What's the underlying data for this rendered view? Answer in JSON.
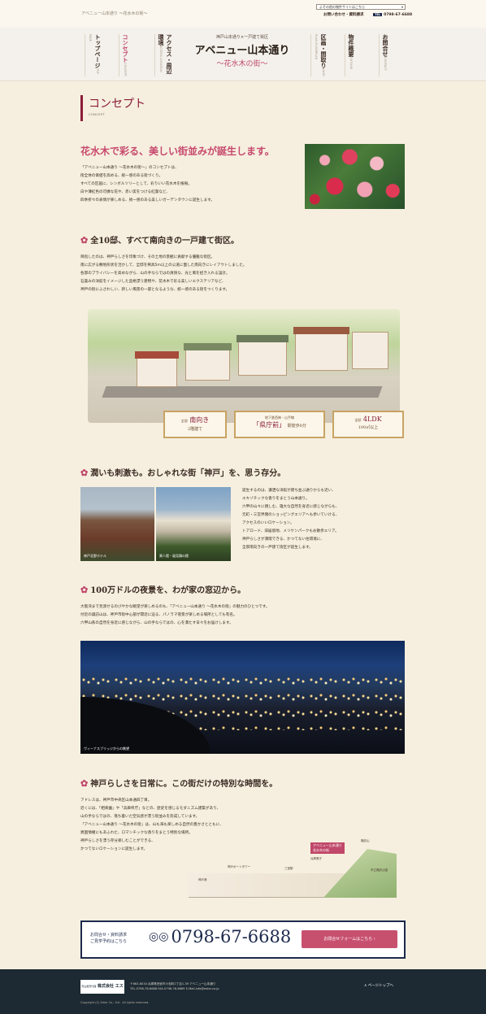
{
  "header": {
    "breadcrumb": "アベニュー山本通り ～花水木の街～",
    "site_select": "よその他の物件サイトはこちら",
    "inquiry_link": "お問い合わせ・資料請求",
    "tel_label": "TEL",
    "tel": "0798-67-6688"
  },
  "nav": {
    "items": [
      {
        "label": "トップページ",
        "sub": "TOP PAGE"
      },
      {
        "label": "コンセプト",
        "sub": "CONCEPT"
      },
      {
        "label": "アクセス・周辺環境",
        "sub": "ACCESS LOCATION"
      },
      {
        "label": "区画・間取り",
        "sub": "LAND PLAN FLOORPLAN"
      },
      {
        "label": "物件概要",
        "sub": "OUTLINE"
      },
      {
        "label": "お問合せ",
        "sub": "CONTACT"
      }
    ],
    "logo_pre": "神戸山本通り×一戸建て街区",
    "logo_main": "アベニュー山本通り",
    "logo_tag": "～花水木の街～"
  },
  "page": {
    "title": "コンセプト",
    "title_sub": "CONCEPT"
  },
  "intro": {
    "heading": "花水木で彩る、美しい街並みが誕生します。",
    "lines": [
      "「アベニュー山本通り ～花水木の街～」のコンセプトは、",
      "街全体の価値を高める、統一感のある街づくり。",
      "すべての区画に、シンボルツリーとして、彩りいい花水木を植樹。",
      "白や薄紅色の可憐な花や、赤い実をつける紅葉など、",
      "四季折々の表情が楽しめる、統一感のある美しいガーデンタウンに誕生します。"
    ]
  },
  "section1": {
    "heading": "全10邸、すべて南向きの一戸建て街区。",
    "lines": [
      "目指したのは、神戸らしさを印象づけ、その土地の景観に貢献する優雅な街区。",
      "南に広がる敷地形状を活かして、全邸を稀具5m以上の公道に面した南向きにレイアウトしました。",
      "各邸のプライバシーを高めながら、山の手ならではの爽快な、光と風を招き入れる設計。",
      "石畳みの洋館をイメージした品格漂う建物や、花水木で彩る美しいエクステリアなど、",
      "神戸の街にふさわしい、新しい風景の一部となるような、統一感のある街をつくります。"
    ],
    "badges": [
      {
        "top": "全邸",
        "main": "南向き",
        "line2": "2階建て"
      },
      {
        "top": "地下鉄西神・山手線",
        "main": "「県庁前」",
        "line2": "駅徒歩8分"
      },
      {
        "top": "全邸",
        "main": "4LDK",
        "line2": "100㎡以上"
      }
    ]
  },
  "section2": {
    "heading": "潤いも刺激も。おしゃれな街「神戸」を、思う存分。",
    "photo1_caption": "神戸北野ホテル",
    "photo2_caption": "異人館・風見鶏の館",
    "lines": [
      "誕生するのは、瀟洒な洋館が建ち並ぶ通りからも近い、",
      "エキゾチックな香りをまとう山本通り。",
      "六甲の山々に親しむ、雄大な自然を身近に感じながらも、",
      "元町・三宮界隈のショッピングエリアへも歩いていける、",
      "アクセスのいいロケーション。",
      "トアロード、旧居留地、メリケンパークもお散歩エリア。",
      "神戸らしさが満喫できる、かつてない住環境に、",
      "全邸南向きの一戸建て街区が誕生します。"
    ]
  },
  "section3": {
    "heading": "100万ドルの夜景を、わが家の窓辺から。",
    "lines": [
      "大阪湾まで見渡せるのびやかな眺望が楽しめるのも、「アベニュー山本通り ～花水木の街」の魅力のひとつです。",
      "付近の諏訪山は、神戸市街中心部が間近に迫る、パノラマ夜景が楽しめる場所としても有名。",
      "六甲山系の自然を身近に感じながら、山の手ならではの、心を満たす日々をお届けします。"
    ],
    "photo_caption": "ヴィーナスブリッジからの眺望"
  },
  "section4": {
    "heading": "神戸らしさを日常に。この街だけの特別な時間を。",
    "lines": [
      "アドレスは、神戸市中央区山本通四丁目。",
      "近くには、「相楽園」や「兵庫県庁」などの、歴史を感じるモダニズム建築があり、",
      "山の手ならではの、落ち着いた空気感が漂う街並みを形成しています。",
      "「アベニュー山本通り ～花水木の街」は、山も海も楽しめる自然の豊かさとともに、",
      "異国情緒にもあふれた、ロマンチックな香りをまとう特別な場所。",
      "神戸らしさを漂う存分楽しむことができる、",
      "かつてないロケーションに誕生します。"
    ],
    "map_labels": {
      "sign": "アベニュー山本通り",
      "sign_sub": "花水木の街",
      "tower": "神戸ポートタワー",
      "port": "神戸港",
      "station": "三宮駅",
      "office": "兵庫県庁",
      "mountain": "諏訪山",
      "park": "市立諏訪公園"
    }
  },
  "contact": {
    "line1": "お問合せ・資料請求",
    "line2": "ご見学予約はこちら",
    "tel": "0798-67-6688",
    "button": "お問合せフォームはこちら ›"
  },
  "footer": {
    "logo_pre": "売主販売代理",
    "logo": "株式会社 エスター",
    "address": "〒663-8034 兵庫県西宮市小松町2丁目1-39 アベニュー山本通り",
    "tel_fax": "TEL.0798-78-6688 FAX.0798-78-6669",
    "email": "E-Mail.info@ester.co.jp",
    "pagetop": "∧ ページトップへ",
    "copyright": "Copyright (C) Ester Co., Ltd . All rights reserved."
  }
}
